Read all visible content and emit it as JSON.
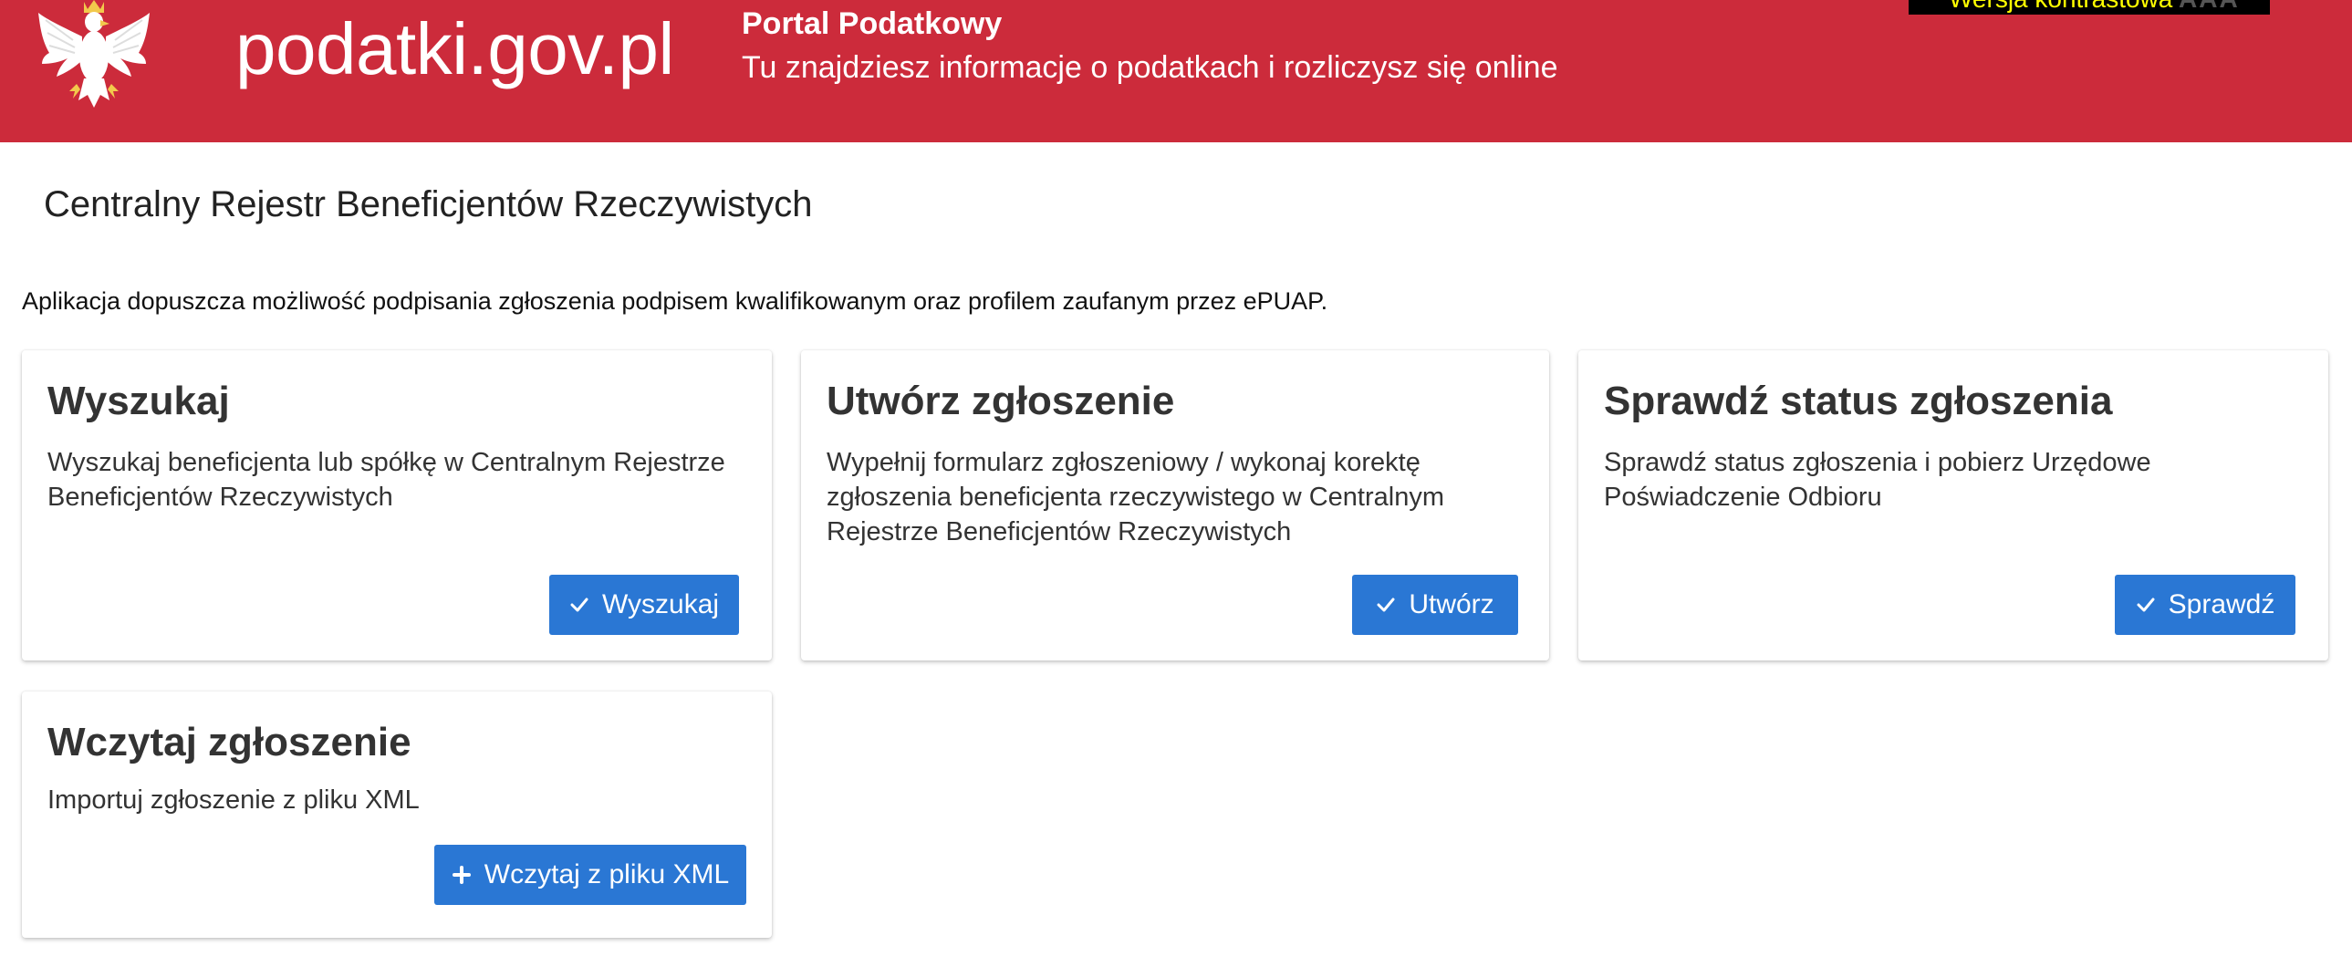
{
  "header": {
    "site_title": "podatki.gov.pl",
    "portal_name": "Portal Podatkowy",
    "portal_tagline": "Tu znajdziesz informacje o podatkach i rozliczysz się online",
    "contrast_label": "Wersja kontrastowa",
    "contrast_marks": "AAA",
    "logo_icon": "polish-eagle-emblem",
    "background_color": "#cc2b3b"
  },
  "page": {
    "title": "Centralny Rejestr Beneficjentów Rzeczywistych",
    "intro": "Aplikacja dopuszcza możliwość podpisania zgłoszenia podpisem kwalifikowanym oraz profilem zaufanym przez ePUAP."
  },
  "cards": [
    {
      "title": "Wyszukaj",
      "description": "Wyszukaj beneficjenta lub spółkę w Centralnym Rejestrze Beneficjentów Rzeczywistych",
      "button_label": "Wyszukaj",
      "button_icon": "check-icon"
    },
    {
      "title": "Utwórz zgłoszenie",
      "description": "Wypełnij formularz zgłoszeniowy / wykonaj korektę zgłoszenia beneficjenta rzeczywistego w Centralnym Rejestrze Beneficjentów Rzeczywistych",
      "button_label": "Utwórz",
      "button_icon": "check-icon"
    },
    {
      "title": "Sprawdź status zgłoszenia",
      "description": "Sprawdź status zgłoszenia i pobierz Urzędowe Poświadczenie Odbioru",
      "button_label": "Sprawdź",
      "button_icon": "check-icon"
    },
    {
      "title": "Wczytaj zgłoszenie",
      "description": "Importuj zgłoszenie z pliku XML",
      "button_label": "Wczytaj z pliku XML",
      "button_icon": "plus-icon"
    }
  ],
  "colors": {
    "accent": "#2a77d4",
    "header_red": "#cc2b3b",
    "contrast_text": "#ffff00"
  }
}
